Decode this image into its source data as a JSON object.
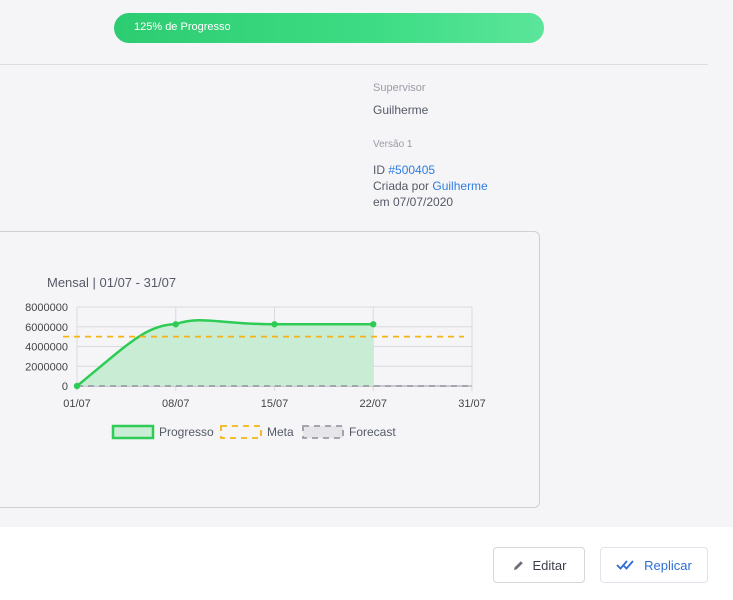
{
  "progress": {
    "label": "125% de Progresso",
    "percent": 125
  },
  "info": {
    "supervisor_label": "Supervisor",
    "supervisor_name": "Guilherme",
    "version": "Versão 1",
    "id_prefix": "ID ",
    "id_value": "#500405",
    "created_by_prefix": "Criada por ",
    "created_by_name": "Guilherme",
    "created_on": "em 07/07/2020"
  },
  "chart_title": "Mensal | 01/07 - 31/07",
  "chart_data": {
    "type": "line",
    "title": "Mensal | 01/07 - 31/07",
    "categories": [
      "01/07",
      "08/07",
      "15/07",
      "22/07",
      "31/07"
    ],
    "y_ticks": [
      "8000000",
      "6000000",
      "4000000",
      "2000000",
      "0"
    ],
    "ylim": [
      0,
      8000000
    ],
    "grid": true,
    "legend_placement": "bottom",
    "series": [
      {
        "name": "Progresso",
        "values": [
          0,
          6250000,
          6250000,
          6250000
        ],
        "color": "#2ecc55",
        "fill": "#c9ecd4",
        "style": "solid-area"
      },
      {
        "name": "Meta",
        "values": [
          5000000,
          5000000,
          5000000,
          5000000,
          5000000
        ],
        "color": "#f5b315",
        "style": "dashed"
      },
      {
        "name": "Forecast",
        "values": [
          0,
          0,
          0,
          0,
          0
        ],
        "color": "#9b9ba6",
        "style": "dashed"
      }
    ]
  },
  "buttons": {
    "edit_label": "Editar",
    "replicate_label": "Replicar"
  },
  "icons": {
    "edit": "pencil-icon",
    "replicate": "double-check-icon"
  }
}
